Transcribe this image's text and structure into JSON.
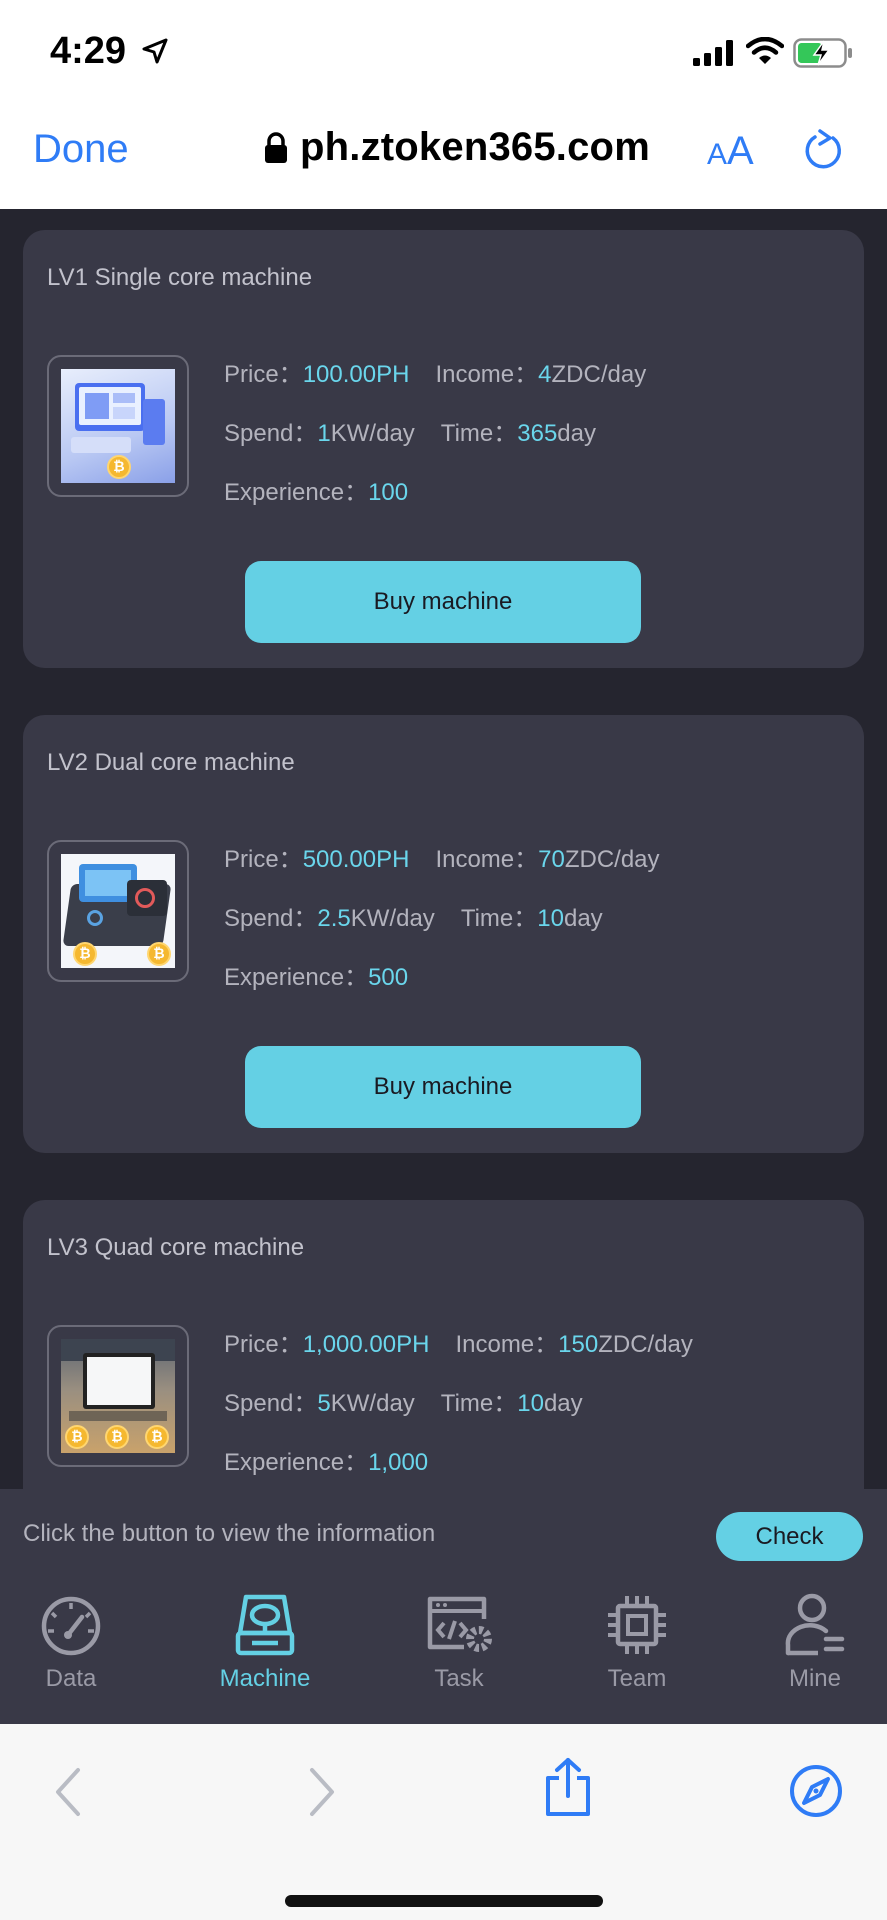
{
  "status": {
    "time": "4:29"
  },
  "browser": {
    "done_label": "Done",
    "url": "ph.ztoken365.com",
    "aa_small": "A",
    "aa_big": "A"
  },
  "machines": [
    {
      "title": "LV1 Single core machine",
      "price_label": "Price：",
      "price": "100.00PH",
      "income_label": "Income：",
      "income_value": "4",
      "income_unit": "ZDC/day",
      "spend_label": "Spend：",
      "spend_value": "1",
      "spend_unit": "KW/day",
      "time_label": "Time：",
      "time_value": "365",
      "time_unit": "day",
      "exp_label": "Experience：",
      "exp_value": "100",
      "button": "Buy machine",
      "coin": "₿"
    },
    {
      "title": "LV2 Dual core machine",
      "price_label": "Price：",
      "price": "500.00PH",
      "income_label": "Income：",
      "income_value": "70",
      "income_unit": "ZDC/day",
      "spend_label": "Spend：",
      "spend_value": "2.5",
      "spend_unit": "KW/day",
      "time_label": "Time：",
      "time_value": "10",
      "time_unit": "day",
      "exp_label": "Experience：",
      "exp_value": "500",
      "button": "Buy machine",
      "coin": "₿"
    },
    {
      "title": "LV3 Quad core machine",
      "price_label": "Price：",
      "price": "1,000.00PH",
      "income_label": "Income：",
      "income_value": "150",
      "income_unit": "ZDC/day",
      "spend_label": "Spend：",
      "spend_value": "5",
      "spend_unit": "KW/day",
      "time_label": "Time：",
      "time_value": "10",
      "time_unit": "day",
      "exp_label": "Experience：",
      "exp_value": "1,000",
      "coin": "₿"
    }
  ],
  "info_bar": {
    "text": "Click the button to view the information",
    "check_label": "Check"
  },
  "tabs": [
    {
      "label": "Data",
      "icon": "gauge-icon"
    },
    {
      "label": "Machine",
      "icon": "machine-icon",
      "active": true
    },
    {
      "label": "Task",
      "icon": "code-gear-icon"
    },
    {
      "label": "Team",
      "icon": "chip-icon"
    },
    {
      "label": "Mine",
      "icon": "user-icon"
    }
  ],
  "colors": {
    "accent": "#64d0e4",
    "card": "#393947",
    "background": "#25252f",
    "ios_blue": "#2f7cf6"
  }
}
